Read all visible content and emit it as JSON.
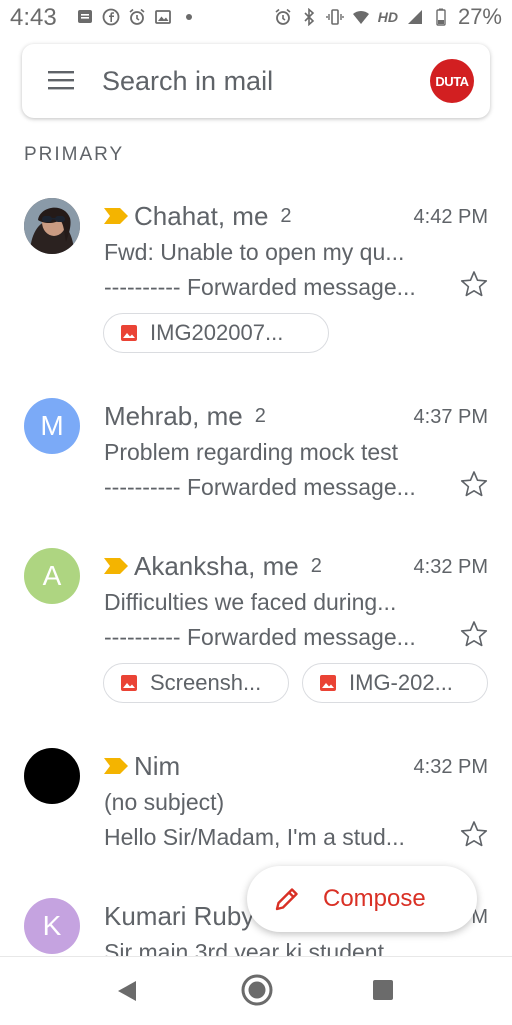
{
  "status_bar": {
    "time": "4:43",
    "network": "HD",
    "battery": "27%"
  },
  "search": {
    "placeholder": "Search in mail",
    "account_label": "DUTA"
  },
  "section": "PRIMARY",
  "emails": [
    {
      "sender": "Chahat, me",
      "count": "2",
      "time": "4:42 PM",
      "subject": "Fwd: Unable to open my qu...",
      "snippet": "---------- Forwarded message...",
      "important": true,
      "avatar": {
        "type": "photo",
        "letter": ""
      },
      "attachments": [
        "IMG202007..."
      ]
    },
    {
      "sender": "Mehrab, me",
      "count": "2",
      "time": "4:37 PM",
      "subject": "Problem regarding mock test",
      "snippet": "---------- Forwarded message...",
      "important": false,
      "avatar": {
        "type": "letter",
        "letter": "M",
        "color": "#7baaf7"
      },
      "attachments": []
    },
    {
      "sender": "Akanksha, me",
      "count": "2",
      "time": "4:32 PM",
      "subject": "Difficulties we faced during...",
      "snippet": "---------- Forwarded message...",
      "important": true,
      "avatar": {
        "type": "letter",
        "letter": "A",
        "color": "#aed581"
      },
      "attachments": [
        "Screensh...",
        "IMG-202..."
      ]
    },
    {
      "sender": "Nim",
      "count": "",
      "time": "4:32 PM",
      "subject": "(no subject)",
      "snippet": "Hello Sir/Madam, I'm a stud...",
      "important": true,
      "avatar": {
        "type": "letter",
        "letter": "",
        "color": "#000000"
      },
      "attachments": []
    },
    {
      "sender": "Kumari Ruby",
      "count": "",
      "time": "M",
      "subject": "Sir main 3rd year ki student",
      "snippet": "",
      "important": false,
      "avatar": {
        "type": "letter",
        "letter": "K",
        "color": "#c5a3e0"
      },
      "attachments": []
    }
  ],
  "compose": {
    "label": "Compose"
  },
  "colors": {
    "accent": "#d93025",
    "important": "#f4b400",
    "attachment": "#ea4335"
  }
}
